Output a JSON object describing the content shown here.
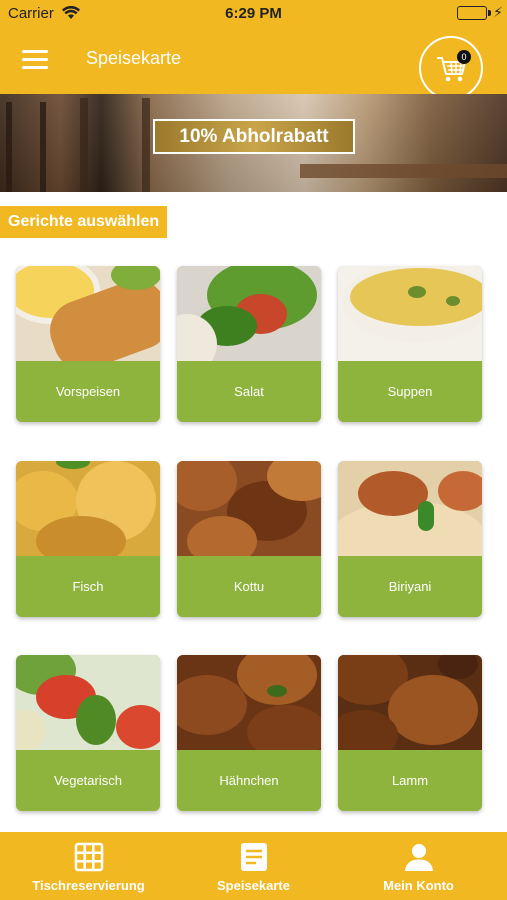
{
  "status_bar": {
    "carrier": "Carrier",
    "time": "6:29 PM",
    "battery_icon": "battery-icon",
    "wifi_icon": "wifi-icon",
    "charging_icon": "bolt-icon"
  },
  "header": {
    "title": "Speisekarte",
    "menu_icon": "hamburger-menu-icon",
    "cart_icon": "shopping-cart-icon",
    "cart_count": "0"
  },
  "banner": {
    "promo_text": "10% Abholrabatt"
  },
  "section": {
    "title": "Gerichte auswählen"
  },
  "categories": [
    {
      "label": "Vorspeisen"
    },
    {
      "label": "Salat"
    },
    {
      "label": "Suppen"
    },
    {
      "label": "Fisch"
    },
    {
      "label": "Kottu"
    },
    {
      "label": "Biriyani"
    },
    {
      "label": "Vegetarisch"
    },
    {
      "label": "Hähnchen"
    },
    {
      "label": "Lamm"
    }
  ],
  "tab_bar": {
    "tabs": [
      {
        "label": "Tischreservierung",
        "icon": "grid-icon"
      },
      {
        "label": "Speisekarte",
        "icon": "menu-document-icon"
      },
      {
        "label": "Mein Konto",
        "icon": "user-icon"
      }
    ]
  },
  "colors": {
    "primary": "#f2b822",
    "tile_green": "#8fb43d",
    "text_on_primary": "#ffffff"
  }
}
